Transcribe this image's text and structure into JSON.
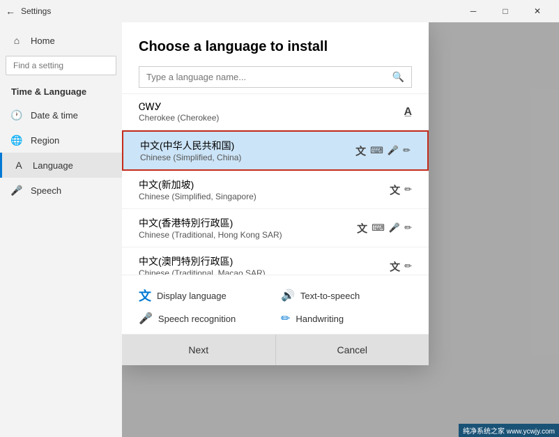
{
  "titlebar": {
    "title": "Settings",
    "minimize_label": "─",
    "maximize_label": "□",
    "close_label": "✕"
  },
  "sidebar": {
    "back_label": "←",
    "settings_title": "Settings",
    "find_placeholder": "Find a setting",
    "nav_items": [
      {
        "id": "home",
        "label": "Home",
        "icon": "⌂"
      },
      {
        "id": "time-language",
        "label": "Time & Language",
        "icon": "",
        "active": true
      },
      {
        "id": "date-time",
        "label": "Date & time",
        "icon": "📅"
      },
      {
        "id": "region",
        "label": "Region",
        "icon": "🌐"
      },
      {
        "id": "language",
        "label": "Language",
        "icon": "A"
      },
      {
        "id": "speech",
        "label": "Speech",
        "icon": "🎤"
      }
    ]
  },
  "dialog": {
    "title": "Choose a language to install",
    "search_placeholder": "Type a language name...",
    "languages": [
      {
        "id": "cwy",
        "name": "ᏣᎳᎩ",
        "subname": "Cherokee (Cherokee)",
        "icons": [
          "A"
        ]
      },
      {
        "id": "zh-cn",
        "name": "中文(中华人民共和国)",
        "subname": "Chinese (Simplified, China)",
        "icons": [
          "A",
          "⌨",
          "🎤",
          "✏"
        ],
        "selected": true
      },
      {
        "id": "zh-sg",
        "name": "中文(新加坡)",
        "subname": "Chinese (Simplified, Singapore)",
        "icons": [
          "A",
          "✏"
        ]
      },
      {
        "id": "zh-hk",
        "name": "中文(香港特別行政區)",
        "subname": "Chinese (Traditional, Hong Kong SAR)",
        "icons": [
          "A",
          "⌨",
          "🎤",
          "✏"
        ]
      },
      {
        "id": "zh-mo",
        "name": "中文(澳門特別行政區)",
        "subname": "Chinese (Traditional, Macao SAR)",
        "icons": [
          "A",
          "✏"
        ]
      }
    ],
    "features": [
      {
        "id": "display",
        "icon": "A",
        "label": "Display language"
      },
      {
        "id": "tts",
        "icon": "🔊",
        "label": "Text-to-speech"
      },
      {
        "id": "speech",
        "icon": "🎤",
        "label": "Speech recognition"
      },
      {
        "id": "handwriting",
        "icon": "✏",
        "label": "Handwriting"
      }
    ],
    "next_label": "Next",
    "cancel_label": "Cancel"
  },
  "watermark": {
    "text": "纯净系统之家 www.ycwjy.com"
  }
}
